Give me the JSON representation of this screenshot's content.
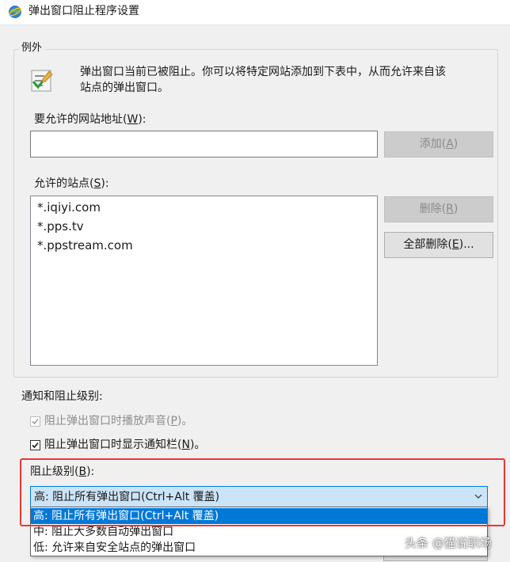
{
  "window": {
    "title": "弹出窗口阻止程序设置",
    "icon": "ie-globe-icon"
  },
  "exceptions": {
    "group_label": "例外",
    "description_line1": "弹出窗口当前已被阻止。你可以将特定网站添加到下表中，从而允许来自该",
    "description_line2": "站点的弹出窗口。",
    "address_label_prefix": "要允许的网站地址(",
    "address_label_key": "W",
    "address_label_suffix": "):",
    "address_value": "",
    "add_button_prefix": "添加(",
    "add_button_key": "A",
    "add_button_suffix": ")",
    "allowed_label_prefix": "允许的站点(",
    "allowed_label_key": "S",
    "allowed_label_suffix": "):",
    "allowed_sites": [
      "*.iqiyi.com",
      "*.pps.tv",
      "*.ppstream.com"
    ],
    "remove_button_prefix": "删除(",
    "remove_button_key": "R",
    "remove_button_suffix": ")",
    "remove_all_button_prefix": "全部删除(",
    "remove_all_button_key": "E",
    "remove_all_button_suffix": ")..."
  },
  "notifications": {
    "group_label": "通知和阻止级别:",
    "sound_label_prefix": "阻止弹出窗口时播放声音(",
    "sound_label_key": "P",
    "sound_label_suffix": ")。",
    "sound_checked": true,
    "sound_enabled": false,
    "bar_label_prefix": "阻止弹出窗口时显示通知栏(",
    "bar_label_key": "N",
    "bar_label_suffix": ")。",
    "bar_checked": true,
    "level_label_prefix": "阻止级别(",
    "level_label_key": "B",
    "level_label_suffix": "):",
    "level_selected": "高: 阻止所有弹出窗口(Ctrl+Alt 覆盖)",
    "level_options": [
      "高: 阻止所有弹出窗口(Ctrl+Alt 覆盖)",
      "中: 阻止大多数自动弹出窗口",
      "低: 允许来自安全站点的弹出窗口"
    ],
    "highlight_color": "#e53935"
  },
  "watermark": "头条 @猫说职场"
}
